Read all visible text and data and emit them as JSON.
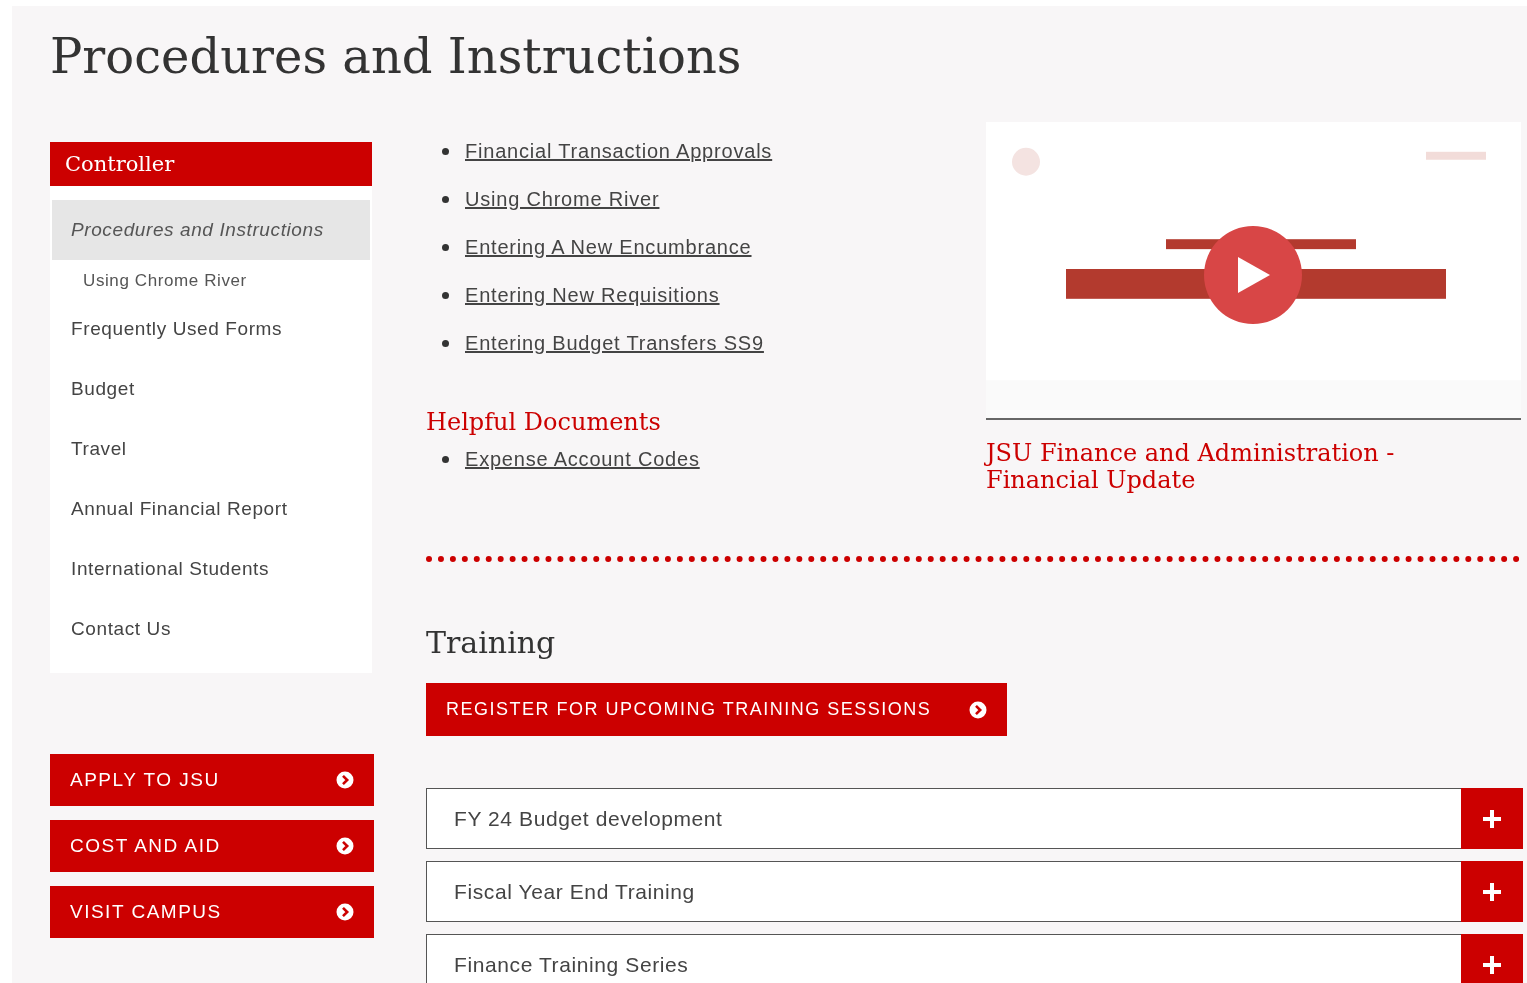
{
  "title": "Procedures and Instructions",
  "sidebar": {
    "heading": "Controller",
    "items": [
      {
        "label": "Procedures and Instructions",
        "selected": true,
        "children": [
          {
            "label": "Using Chrome River",
            "selected": false
          }
        ]
      },
      {
        "label": "Frequently Used Forms",
        "selected": false
      },
      {
        "label": "Budget",
        "selected": false
      },
      {
        "label": "Travel",
        "selected": false
      },
      {
        "label": "Annual Financial Report",
        "selected": false
      },
      {
        "label": "International Students",
        "selected": false
      },
      {
        "label": "Contact Us",
        "selected": false
      }
    ]
  },
  "quick_links": [
    "APPLY TO JSU",
    "COST AND AID",
    "VISIT CAMPUS"
  ],
  "links": [
    "Financial Transaction Approvals",
    "Using Chrome River",
    "Entering A New Encumbrance",
    "Entering New Requisitions",
    "Entering Budget Transfers SS9"
  ],
  "helpful_documents": {
    "heading": "Helpful Documents",
    "links": [
      "Expense Account Codes"
    ]
  },
  "video": {
    "kind": "picture",
    "caption": "JSU Finance and Administration - Financial Update"
  },
  "training": {
    "heading": "Training",
    "button": "REGISTER FOR UPCOMING TRAINING SESSIONS",
    "accordions": [
      {
        "label": "FY 24 Budget development",
        "expanded": false
      },
      {
        "label": "Fiscal Year End Training",
        "expanded": false
      },
      {
        "label": "Finance Training Series",
        "expanded": false
      }
    ]
  }
}
